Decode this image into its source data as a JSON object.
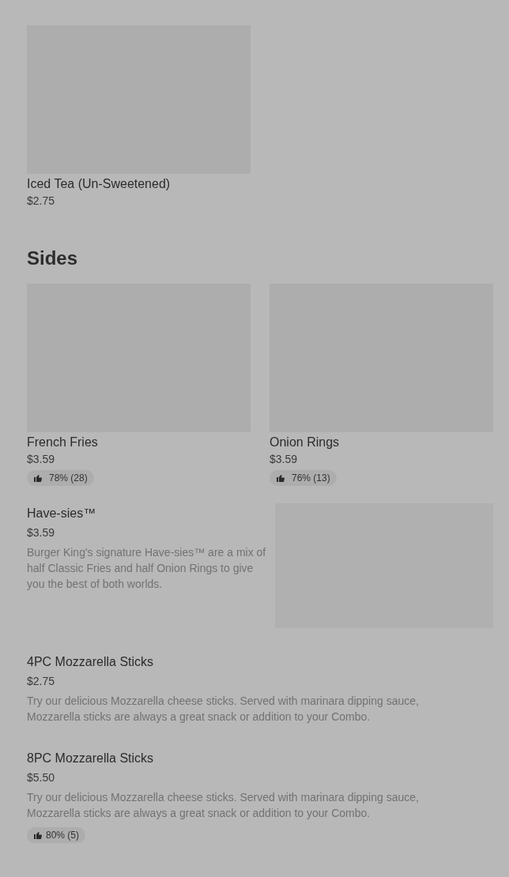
{
  "sections": [
    {
      "items": [
        {
          "kind": "card",
          "name": "Iced Tea (Un-Sweetened)",
          "price": "$2.75"
        }
      ]
    },
    {
      "title": "Sides",
      "items": [
        {
          "kind": "card",
          "name": "French Fries",
          "price": "$3.59",
          "rating": "78% (28)"
        },
        {
          "kind": "card",
          "name": "Onion Rings",
          "price": "$3.59",
          "rating": "76% (13)"
        },
        {
          "kind": "feature",
          "name": "Have-sies™",
          "price": "$3.59",
          "description": "Burger King's signature Have-sies™ are a mix of half Classic Fries and half Onion Rings to give you the best of both worlds."
        },
        {
          "kind": "row",
          "name": "4PC Mozzarella Sticks",
          "price": "$2.75",
          "description": "Try our delicious Mozzarella cheese sticks. Served with marinara dipping sauce, Mozzarella sticks are always a great snack or addition to your Combo."
        },
        {
          "kind": "row",
          "name": "8PC Mozzarella Sticks",
          "price": "$5.50",
          "description": "Try our delicious Mozzarella cheese sticks. Served with marinara dipping sauce, Mozzarella sticks are always a great snack or addition to your Combo.",
          "rating": "80% (5)"
        }
      ]
    }
  ]
}
